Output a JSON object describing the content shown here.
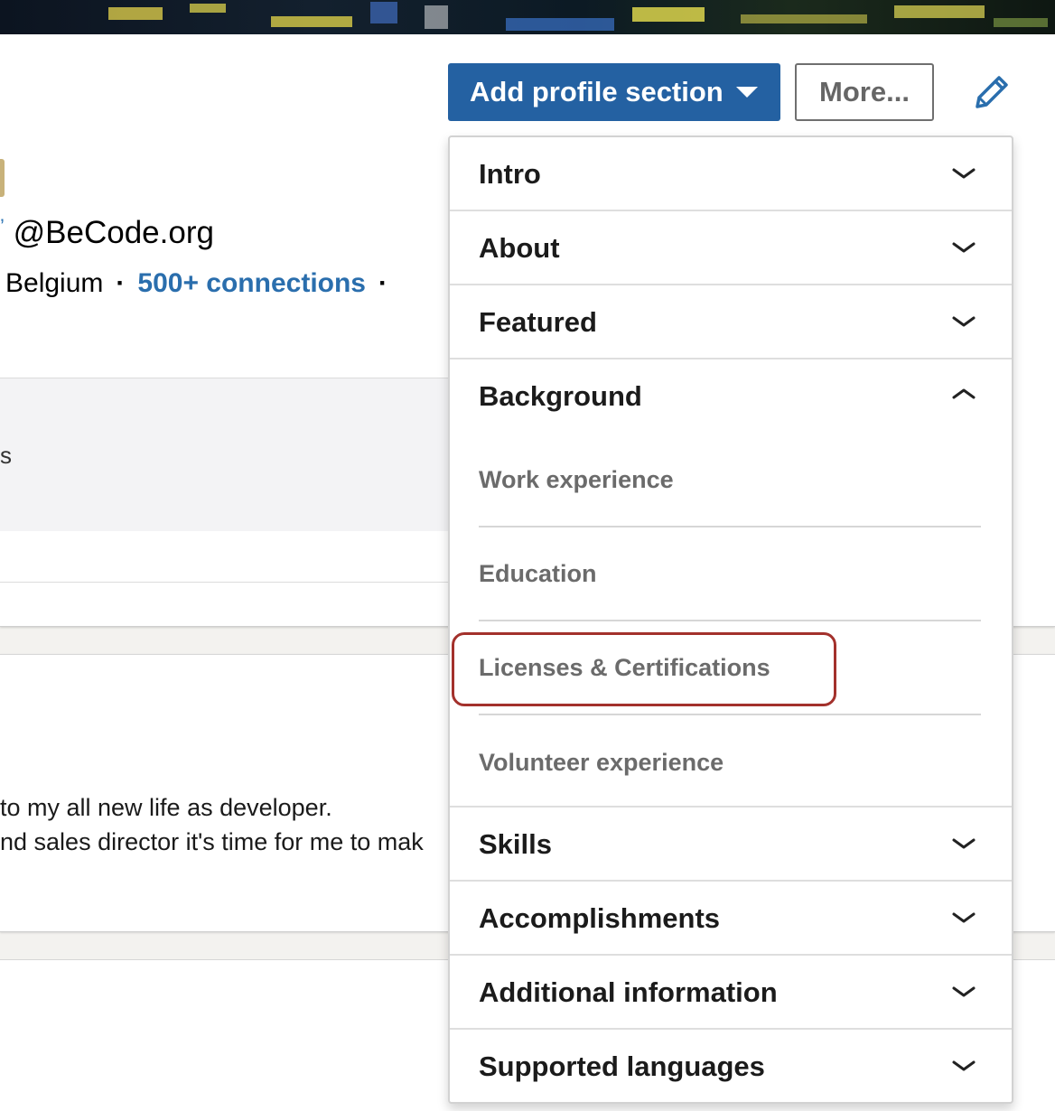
{
  "profile": {
    "org_handle": "@BeCode.org",
    "location": "Belgium",
    "separator": "·",
    "connections": "500+ connections",
    "inset_text": "s"
  },
  "about": {
    "line1": "to my all new life as developer.",
    "line2": "nd sales director it's time for me to mak"
  },
  "toolbar": {
    "add_section_label": "Add profile section",
    "more_label": "More..."
  },
  "dropdown": {
    "sections_top": [
      {
        "label": "Intro",
        "expanded": false
      },
      {
        "label": "About",
        "expanded": false
      },
      {
        "label": "Featured",
        "expanded": false
      }
    ],
    "background": {
      "label": "Background",
      "expanded": true,
      "items": [
        {
          "label": "Work experience"
        },
        {
          "label": "Education"
        },
        {
          "label": "Licenses & Certifications",
          "highlighted": true
        },
        {
          "label": "Volunteer experience"
        }
      ]
    },
    "sections_bottom": [
      {
        "label": "Skills",
        "expanded": false
      },
      {
        "label": "Accomplishments",
        "expanded": false
      },
      {
        "label": "Additional information",
        "expanded": false
      },
      {
        "label": "Supported languages",
        "expanded": false
      }
    ]
  },
  "colors": {
    "primary_button": "#2461a2",
    "link": "#2a6ead",
    "highlight_outline": "#a3312c"
  },
  "icons": {
    "expand": "chevron-down-icon",
    "collapse": "chevron-up-icon",
    "edit": "pencil-icon",
    "dropdown_caret": "caret-down-icon"
  }
}
